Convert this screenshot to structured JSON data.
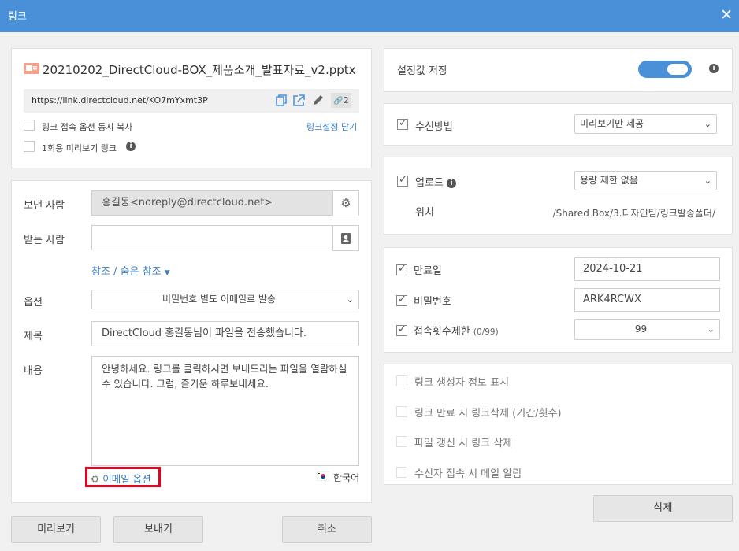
{
  "window": {
    "title": "링크"
  },
  "file": {
    "name": "20210202_DirectCloud-BOX_제품소개_발표자료_v2.pptx",
    "url": "https://link.directcloud.net/KO7mYxmt3P",
    "link_count": "2",
    "copy_with_options_label": "링크 접속 옵션 동시 복사",
    "close_settings_link": "링크설정 닫기",
    "one_time_preview_label": "1회용 미리보기 링크"
  },
  "mail": {
    "sender_label": "보낸 사람",
    "sender_value": "홍길동<noreply@directcloud.net>",
    "recipient_label": "받는 사람",
    "recipient_value": "",
    "cc_bcc_link": "참조 / 숨은 참조",
    "options_label": "옵션",
    "options_value": "비밀번호 별도 이메일로 발송",
    "subject_label": "제목",
    "subject_value": "DirectCloud 홍길동님이 파일을 전송했습니다.",
    "body_label": "내용",
    "body_value": "안녕하세요. 링크를 클릭하시면 보내드리는 파일을 열람하실 수 있습니다. 그럼, 즐거운 하루보내세요.",
    "email_options_link": "이메일 옵션",
    "language": "한국어"
  },
  "buttons": {
    "preview": "미리보기",
    "send": "보내기",
    "cancel": "취소",
    "delete": "삭제"
  },
  "settings": {
    "save_label": "설정값 저장",
    "save_enabled": true,
    "receive_method_label": "수신방법",
    "receive_method_value": "미리보기만 제공",
    "upload_label": "업로드",
    "upload_value": "용량 제한 없음",
    "location_label": "위치",
    "location_value": "/Shared Box/3.디자인팀/링크발송폴더/",
    "expiry_label": "만료일",
    "expiry_value": "2024-10-21",
    "password_label": "비밀번호",
    "password_value": "ARK4RCWX",
    "access_limit_label": "접속횟수제한",
    "access_limit_count": "(0/99)",
    "access_limit_value": "99",
    "extra_options": [
      "링크 생성자 정보 표시",
      "링크 만료 시 링크삭제 (기간/횟수)",
      "파일 갱신 시 링크 삭제",
      "수신자 접속 시 메일 알림"
    ]
  },
  "colors": {
    "titlebar": "#4a90d9",
    "highlight": "#e8001c",
    "link": "#3a7fc4"
  }
}
